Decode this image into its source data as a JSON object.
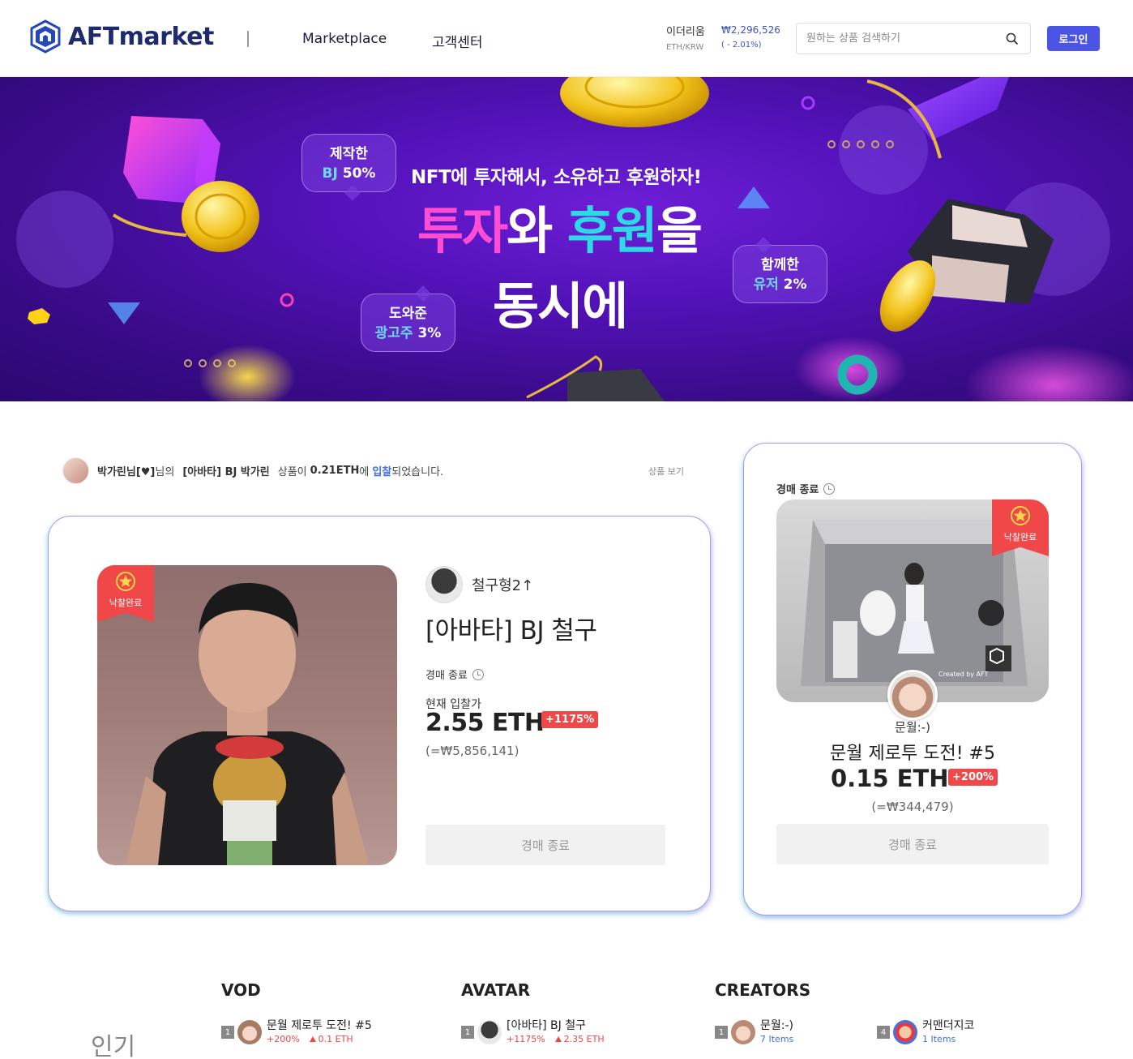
{
  "header": {
    "logo_text": "AFTmarket",
    "nav": [
      "Marketplace",
      "고객센터"
    ],
    "eth": {
      "name": "이더리움",
      "pair": "ETH/KRW",
      "price": "₩2,296,526",
      "change": "( - 2.01%)"
    },
    "search_placeholder": "원하는 상품 검색하기",
    "login_label": "로그인"
  },
  "banner": {
    "subtitle": "NFT에 투자해서, 소유하고 후원하자!",
    "main_pink": "투자",
    "main_mid": "와 ",
    "main_cyan": "후원",
    "main_end": "을",
    "main_line2": "동시에",
    "bubbles": [
      {
        "line1": "제작한",
        "hl": "BJ",
        "rest": " 50%"
      },
      {
        "line1": "도와준",
        "hl": "광고주",
        "rest": " 3%"
      },
      {
        "line1": "함께한",
        "hl": "유저",
        "rest": " 2%"
      }
    ]
  },
  "activity": {
    "user": "박가린님[♥]",
    "part1": "님의",
    "item": "[아바타] BJ 박가린",
    "part2": "상품이",
    "amount": "0.21ETH",
    "part3": "에",
    "bid_word": "입찰",
    "part4": "되었습니다.",
    "link": "상품 보기"
  },
  "main_card": {
    "ribbon": "낙찰완료",
    "seller": "철구형2↑",
    "title": "[아바타] BJ 철구",
    "status": "경매 종료",
    "bid_label": "현재 입찰가",
    "price": "2.55 ETH",
    "pct": "+1175%",
    "krw": "(=₩5,856,141)",
    "button": "경매 종료"
  },
  "side_card": {
    "status": "경매 종료",
    "ribbon": "낙찰완료",
    "watermark": "Created by AFT",
    "creator": "문월:-)",
    "title": "문월 제로투 도전! #5",
    "price": "0.15 ETH",
    "pct": "+200%",
    "krw": "(=₩344,479)",
    "button": "경매 종료"
  },
  "popular": {
    "label": "인기",
    "columns": [
      {
        "title": "VOD"
      },
      {
        "title": "AVATAR"
      },
      {
        "title": "CREATORS"
      }
    ],
    "vod": {
      "rank": "1",
      "name": "문월 제로투 도전! #5",
      "pct": "+200%",
      "eth": "0.1 ETH"
    },
    "avatar": {
      "rank": "1",
      "name": "[아바타] BJ 철구",
      "pct": "+1175%",
      "eth": "2.35 ETH"
    },
    "creators": [
      {
        "rank": "1",
        "name": "문월:-)",
        "items": "7 Items"
      },
      {
        "rank": "4",
        "name": "커맨더지코",
        "items": "1 Items"
      }
    ]
  },
  "colors": {
    "accent": "#4b55e5",
    "badge_red": "#f04848",
    "banner_purple": "#5212b8"
  }
}
